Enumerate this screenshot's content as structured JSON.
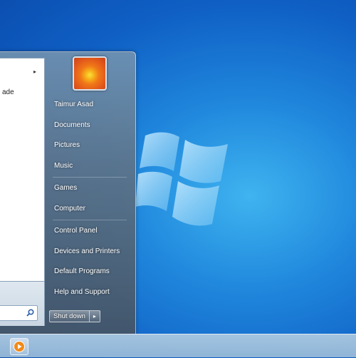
{
  "start_menu": {
    "left_pane": {
      "fragment_text": "ade",
      "submenu_arrow": "▸"
    },
    "user_name": "Taimur Asad",
    "right_items_group1": [
      "Documents",
      "Pictures",
      "Music"
    ],
    "right_items_group2": [
      "Games",
      "Computer"
    ],
    "right_items_group3": [
      "Control Panel",
      "Devices and Printers",
      "Default Programs",
      "Help and Support"
    ],
    "shutdown_label": "Shut down",
    "shutdown_arrow": "▸"
  },
  "icons": {
    "search": "search-icon",
    "media_player": "media-player-icon",
    "windows_logo": "windows-logo-icon"
  }
}
